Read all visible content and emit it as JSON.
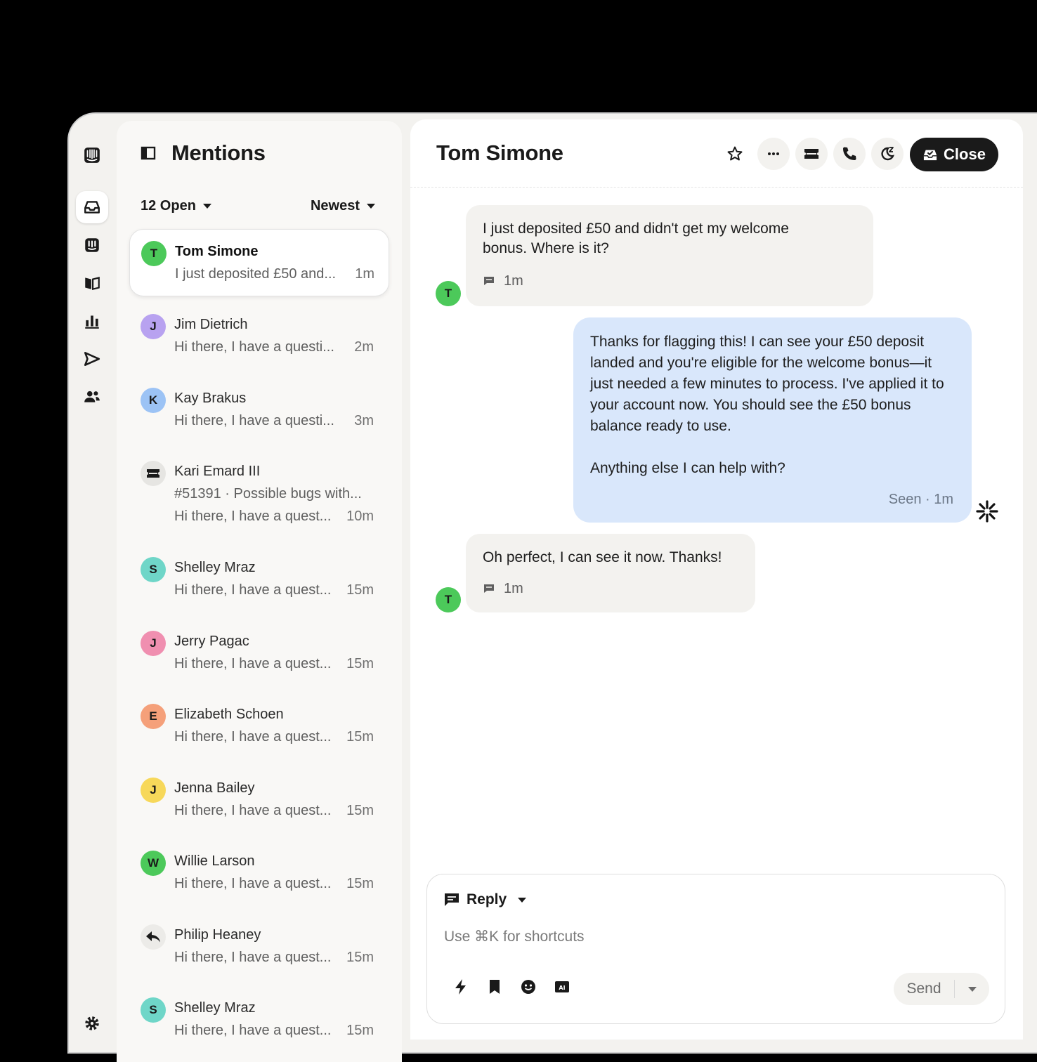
{
  "list": {
    "title": "Mentions",
    "filter_open": "12 Open",
    "sort": "Newest",
    "conversations": [
      {
        "initial": "T",
        "name": "Tom Simone",
        "preview": "I just deposited £50 and...",
        "time": "1m",
        "color": "#4cc95a"
      },
      {
        "initial": "J",
        "name": "Jim Dietrich",
        "preview": "Hi there, I have a questi...",
        "time": "2m",
        "color": "#b8a2f0"
      },
      {
        "initial": "K",
        "name": "Kay Brakus",
        "preview": "Hi there, I have a questi...",
        "time": "3m",
        "color": "#9cc3f5"
      },
      {
        "initial": "",
        "name": "Kari Emard III",
        "ticket": "#51391 · Possible bugs with...",
        "preview": "Hi there, I have a quest...",
        "time": "10m",
        "color": "#e6e5e2",
        "icon": "ticket-icon"
      },
      {
        "initial": "S",
        "name": "Shelley Mraz",
        "preview": "Hi there, I have a quest...",
        "time": "15m",
        "color": "#6fd6c8"
      },
      {
        "initial": "J",
        "name": "Jerry Pagac",
        "preview": "Hi there, I have a quest...",
        "time": "15m",
        "color": "#f08fb0"
      },
      {
        "initial": "E",
        "name": "Elizabeth Schoen",
        "preview": "Hi there, I have a quest...",
        "time": "15m",
        "color": "#f5a07a"
      },
      {
        "initial": "J",
        "name": "Jenna Bailey",
        "preview": "Hi there, I have a quest...",
        "time": "15m",
        "color": "#f7d85a"
      },
      {
        "initial": "W",
        "name": "Willie Larson",
        "preview": "Hi there, I have a quest...",
        "time": "15m",
        "color": "#4cc95a"
      },
      {
        "initial": "",
        "name": "Philip Heaney",
        "preview": "Hi there, I have a quest...",
        "time": "15m",
        "color": "#ecebe8",
        "icon": "reply-arrow-icon"
      },
      {
        "initial": "S",
        "name": "Shelley Mraz",
        "preview": "Hi there, I have a quest...",
        "time": "15m",
        "color": "#6fd6c8"
      }
    ]
  },
  "conversation": {
    "title": "Tom Simone",
    "close_label": "Close",
    "messages": {
      "m1": {
        "text": "I just deposited £50 and didn't get my welcome bonus. Where is it?",
        "time": "1m",
        "avatar": "T"
      },
      "m2": {
        "p1": "Thanks for flagging this! I can see your £50 deposit landed and you're eligible for the welcome bonus—it just needed a few minutes to process. I've applied it to your account now. You should see the £50 bonus balance ready to use.",
        "p2": "Anything else I can help with?",
        "seen": "Seen · 1m"
      },
      "m3": {
        "text": "Oh perfect, I can see it now. Thanks!",
        "time": "1m",
        "avatar": "T"
      }
    }
  },
  "composer": {
    "mode": "Reply",
    "placeholder": "Use ⌘K for shortcuts",
    "send": "Send"
  },
  "colors": {
    "accent": "#1a1a1a",
    "agent_bubble": "#d9e7fb",
    "customer_bubble": "#f3f2ef"
  }
}
